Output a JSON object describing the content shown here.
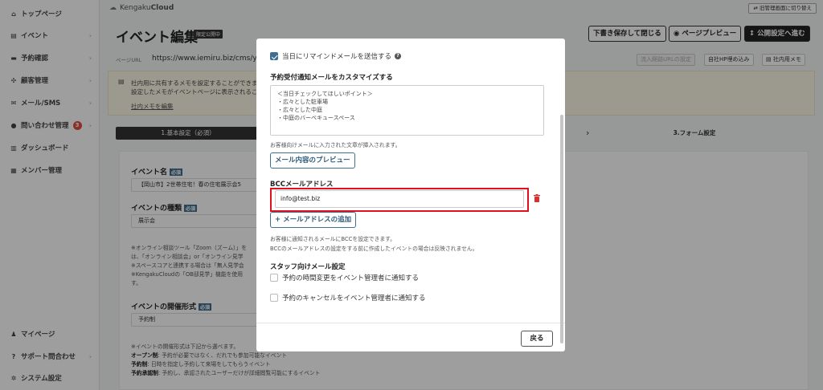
{
  "sidebar": {
    "items": [
      {
        "label": "トップページ",
        "icon": "home-icon",
        "glyph": "⌂",
        "chevron": false
      },
      {
        "label": "イベント",
        "icon": "document-icon",
        "glyph": "▤",
        "chevron": true
      },
      {
        "label": "予約確認",
        "icon": "calendar-icon",
        "glyph": "▬",
        "chevron": true
      },
      {
        "label": "顧客管理",
        "icon": "customers-icon",
        "glyph": "✣",
        "chevron": true
      },
      {
        "label": "メール/SMS",
        "icon": "mail-icon",
        "glyph": "✉",
        "chevron": true
      },
      {
        "label": "問い合わせ管理",
        "icon": "chat-icon",
        "glyph": "●",
        "chevron": true,
        "badge": "3"
      },
      {
        "label": "ダッシュボード",
        "icon": "dashboard-icon",
        "glyph": "▥",
        "chevron": false
      },
      {
        "label": "メンバー管理",
        "icon": "grid-icon",
        "glyph": "▦",
        "chevron": false
      }
    ],
    "bottom_items": [
      {
        "label": "マイページ",
        "icon": "user-icon",
        "glyph": "♟",
        "chevron": false
      },
      {
        "label": "サポート問合わせ",
        "icon": "help-circle-icon",
        "glyph": "?",
        "chevron": true
      },
      {
        "label": "システム設定",
        "icon": "gear-icon",
        "glyph": "✲",
        "chevron": false
      }
    ]
  },
  "header": {
    "logo_prefix": "Kengaku",
    "logo_suffix": "Cloud",
    "switch_label": "旧管理画面に切り替え",
    "title": "イベント編集",
    "status_badge": "限定公開中",
    "save_draft": "下書き保存して閉じる",
    "page_preview": "ページプレビュー",
    "publish": "公開設定へ進む"
  },
  "url_row": {
    "label": "ページURL",
    "url": "https://www.iemiru.biz/cms/yo",
    "copy_btn": "流入経路URLの設定",
    "embed_btn": "自社HP埋め込み",
    "memo_btn": "社内用メモ"
  },
  "memo": {
    "line1": "社内用に共有するメモを設定することができます",
    "line2": "設定したメモがイベントページに表示されるこ",
    "link": "社内メモを編集"
  },
  "steps": {
    "step1": "1.基本設定（必須）",
    "step3": "3.フォーム設定"
  },
  "form": {
    "event_name_label": "イベント名",
    "required": "必須",
    "event_name_value": "【岡山市】2世帯住宅！春の住宅展示会5",
    "event_type_label": "イベントの種類",
    "event_type_value": "展示会",
    "online_note_1": "※オンライン相談ツール「Zoom（ズーム）」を",
    "online_note_2": "は、「オンライン相談会」or「オンライン見学",
    "online_note_3": "※スペースコアと連携する場合は「無人見学会",
    "online_note_4": "※KengakuCloudの「OB邸見学」機能を使用",
    "online_note_5": "す。",
    "format_label": "イベントの開催形式",
    "format_value": "予約制",
    "format_note": "※イベントの開催形式は下記から選べます。",
    "format_open": "オープン制",
    "format_open_desc": ": 予約が必要ではなく、だれでも参加可能なイベント",
    "format_reserve": "予約制",
    "format_reserve_desc": ": 日時を指定し予約して来場をしてもらうイベント",
    "format_approval": "予約承認制",
    "format_approval_desc": ": 予約し、承認されたユーザーだけが詳細閲覧可能にするイベント"
  },
  "modal": {
    "reminder_label": "当日にリマインドメールを送信する",
    "reminder_checked": true,
    "customize_heading": "予約受付通知メールをカスタマイズする",
    "textarea_value": "＜当日チェックしてほしいポイント＞\n・広々とした駐車場\n・広々とした中庭\n・中庭のバーベキュースペース",
    "customer_note": "お客様向けメールに入力された文章が挿入されます。",
    "preview_btn": "メール内容のプレビュー",
    "bcc_heading": "BCCメールアドレス",
    "bcc_email": "info@test.biz",
    "add_email_btn": "+ メールアドレスの追加",
    "bcc_note_1": "お客様に通知されるメールにBCCを設定できます。",
    "bcc_note_2": "BCCのメールアドレスの設定をする前に作成したイベントの場合は反映されません。",
    "staff_heading": "スタッフ向けメール設定",
    "staff_opt_1": "予約の時間変更をイベント管理者に通知する",
    "staff_opt_2": "予約のキャンセルをイベント管理者に通知する",
    "back_btn": "戻る"
  },
  "colors": {
    "accent": "#3d6f90",
    "highlight": "#e01020",
    "badge": "#e14d3f",
    "trash": "#d9302f"
  }
}
